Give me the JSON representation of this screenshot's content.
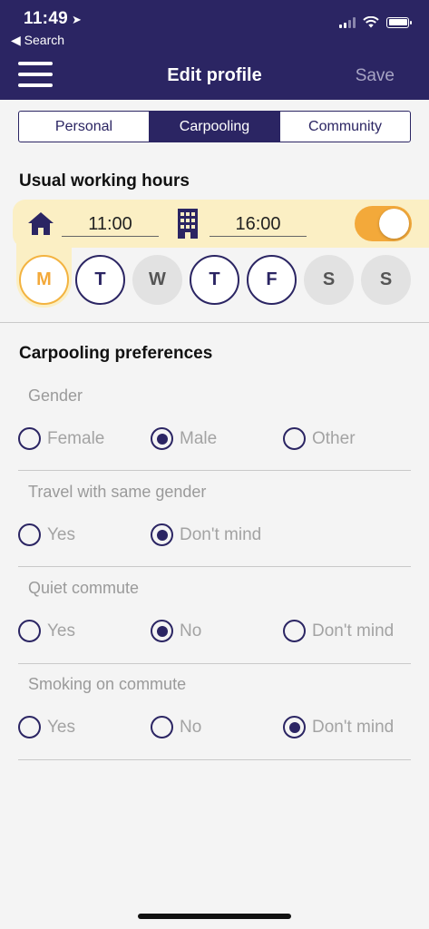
{
  "status_bar": {
    "time": "11:49",
    "back_label": "◀ Search"
  },
  "header": {
    "title": "Edit profile",
    "save_label": "Save"
  },
  "tabs": [
    {
      "label": "Personal",
      "active": false
    },
    {
      "label": "Carpooling",
      "active": true
    },
    {
      "label": "Community",
      "active": false
    }
  ],
  "working_hours": {
    "title": "Usual working hours",
    "start_time": "11:00",
    "end_time": "16:00",
    "enabled": true,
    "days": [
      {
        "label": "M",
        "state": "today"
      },
      {
        "label": "T",
        "state": "on"
      },
      {
        "label": "W",
        "state": "off"
      },
      {
        "label": "T",
        "state": "on"
      },
      {
        "label": "F",
        "state": "on"
      },
      {
        "label": "S",
        "state": "off"
      },
      {
        "label": "S",
        "state": "off"
      }
    ]
  },
  "preferences": {
    "title": "Carpooling preferences",
    "groups": [
      {
        "label": "Gender",
        "options": [
          "Female",
          "Male",
          "Other"
        ],
        "selected": "Male"
      },
      {
        "label": "Travel with same gender",
        "options": [
          "Yes",
          "Don't mind"
        ],
        "selected": "Don't mind"
      },
      {
        "label": "Quiet commute",
        "options": [
          "Yes",
          "No",
          "Don't mind"
        ],
        "selected": "No"
      },
      {
        "label": "Smoking on commute",
        "options": [
          "Yes",
          "No",
          "Don't mind"
        ],
        "selected": "Don't mind"
      }
    ]
  },
  "colors": {
    "primary": "#2b2563",
    "accent": "#f3a93a",
    "highlight": "#fbefc4"
  }
}
